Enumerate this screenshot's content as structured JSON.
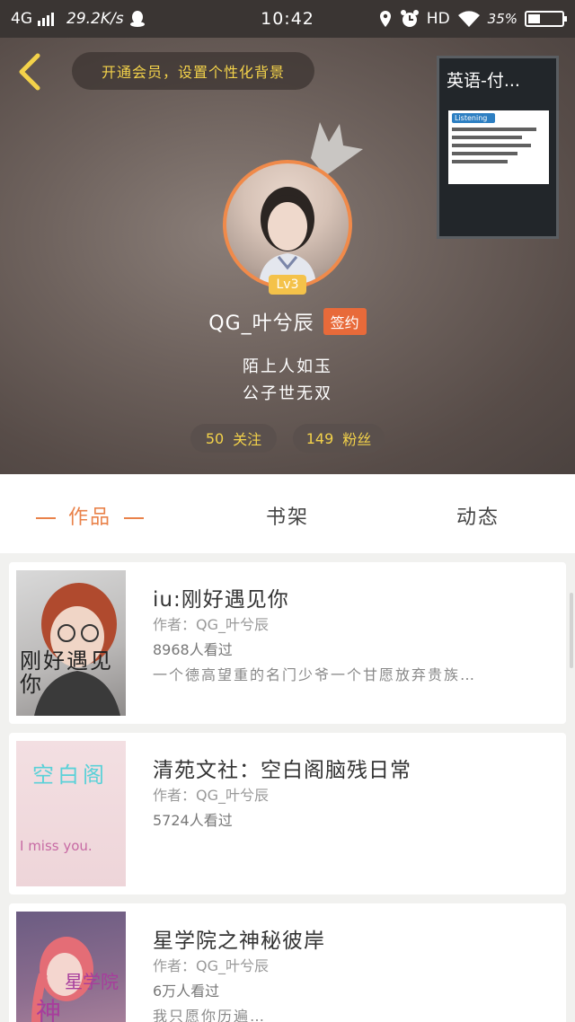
{
  "status_bar": {
    "network": "4G",
    "speed": "29.2K/s",
    "time": "10:42",
    "hd": "HD",
    "battery": "35%",
    "battery_level": 0.35,
    "icons": [
      "signal-icon",
      "qq-icon",
      "location-icon",
      "alarm-icon",
      "wifi-icon",
      "battery-icon"
    ]
  },
  "header": {
    "vip_banner": "开通会员，设置个性化背景",
    "floating_window_title": "英语-付...",
    "floating_thumb_heading": "Listening",
    "level": "Lv3",
    "username": "QG_叶兮辰",
    "signed_tag": "签约",
    "bio_line1": "陌上人如玉",
    "bio_line2": "公子世无双",
    "following": {
      "count": "50",
      "label": "关注"
    },
    "fans": {
      "count": "149",
      "label": "粉丝"
    },
    "accent": "#f3d24a"
  },
  "tabs": [
    {
      "label": "作品",
      "active": true
    },
    {
      "label": "书架",
      "active": false
    },
    {
      "label": "动态",
      "active": false
    }
  ],
  "books": [
    {
      "title": "iu:刚好遇见你",
      "author": "作者：QG_叶兮辰",
      "views": "8968人看过",
      "desc": "一个德高望重的名门少爷一个甘愿放弃贵族…",
      "cover_text": "刚好遇见你"
    },
    {
      "title": "清苑文社：空白阁脑残日常",
      "author": "作者：QG_叶兮辰",
      "views": "5724人看过",
      "desc": "",
      "cover_text": "空白阁",
      "cover_sub": "I miss you."
    },
    {
      "title": "星学院之神秘彼岸",
      "author": "作者：QG_叶兮辰",
      "views": "6万人看过",
      "desc": "我只愿你历遍…",
      "cover_text": "星学院",
      "cover_sub": "神"
    }
  ],
  "colors": {
    "accent_orange": "#e9824a",
    "header_bg": "#6e625d"
  }
}
